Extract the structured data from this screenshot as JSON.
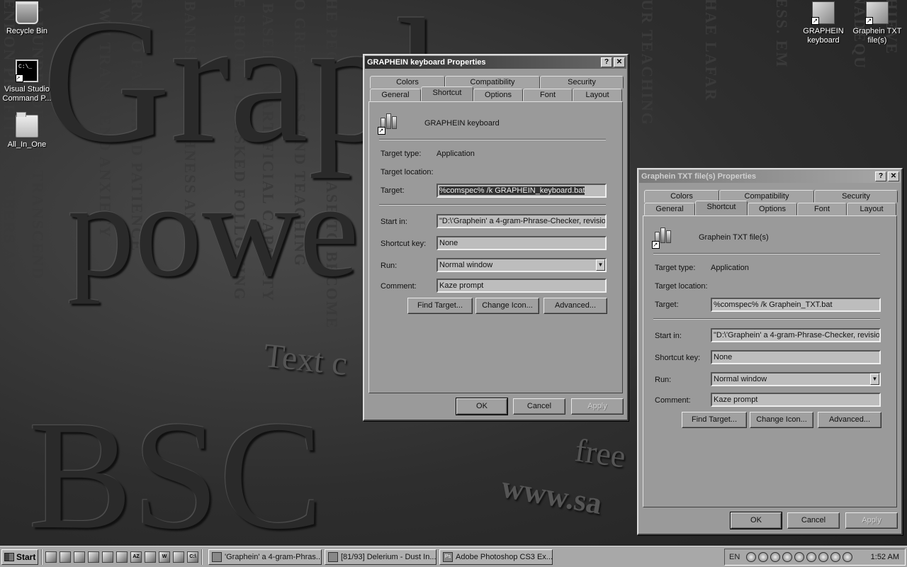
{
  "wallpaper": {
    "big_line1": "Graph -",
    "big_line2": "powe",
    "big_line3": "BSC",
    "small1": "Text c",
    "small2": "free",
    "small3": "www.sa",
    "columns": [
      "RENDON PROFIT: ~ ROBBERS AND",
      "O A HUNDREDFOLD: TRANSCEND",
      "W WU TRANSCEND ANXIETY",
      "URN TO FAITH AND PATIENCE",
      "~ BANISH SELFISHNESS AND",
      "E BASED ON ARTIFICIAL CAPACITY",
      "DO GREATNESS AND TEACHING",
      "LE SHOULD BE ASKED FOLLOWING",
      "THE PEOPLE WILL CEASE TO BECOME",
      "OUR TEACHING",
      "CHAE LAFAR",
      "LESS. EM",
      "INADEQU",
      "THIEVE"
    ]
  },
  "desktop_icons": [
    {
      "label": "Recycle Bin",
      "icon": "recycle-bin-icon"
    },
    {
      "label": "Visual Studio Command P...",
      "icon": "command-prompt-icon"
    },
    {
      "label": "All_In_One",
      "icon": "folder-icon"
    },
    {
      "label": "GRAPHEIN keyboard",
      "icon": "graphein-shortcut-icon"
    },
    {
      "label": "Graphein TXT file(s)",
      "icon": "graphein-shortcut-icon"
    }
  ],
  "dialog1": {
    "title": "GRAPHEIN keyboard Properties",
    "tabs_back": [
      "Colors",
      "Compatibility",
      "Security"
    ],
    "tabs_front": [
      "General",
      "Shortcut",
      "Options",
      "Font",
      "Layout"
    ],
    "name": "GRAPHEIN keyboard",
    "target_type_label": "Target type:",
    "target_type_value": "Application",
    "target_location_label": "Target location:",
    "target_label": "Target:",
    "target_value": "%comspec% /k GRAPHEIN_keyboard.bat",
    "start_in_label": "Start in:",
    "start_in_value": "\"D:\\'Graphein' a 4-gram-Phrase-Checker, revision",
    "shortcut_key_label": "Shortcut key:",
    "shortcut_key_value": "None",
    "run_label": "Run:",
    "run_value": "Normal window",
    "comment_label": "Comment:",
    "comment_value": "Kaze prompt",
    "find_target": "Find Target...",
    "change_icon": "Change Icon...",
    "advanced": "Advanced...",
    "ok": "OK",
    "cancel": "Cancel",
    "apply": "Apply"
  },
  "dialog2": {
    "title": "Graphein TXT file(s) Properties",
    "tabs_back": [
      "Colors",
      "Compatibility",
      "Security"
    ],
    "tabs_front": [
      "General",
      "Shortcut",
      "Options",
      "Font",
      "Layout"
    ],
    "name": "Graphein TXT file(s)",
    "target_type_label": "Target type:",
    "target_type_value": "Application",
    "target_location_label": "Target location:",
    "target_label": "Target:",
    "target_value": "%comspec% /k Graphein_TXT.bat",
    "start_in_label": "Start in:",
    "start_in_value": "\"D:\\'Graphein' a 4-gram-Phrase-Checker, revision",
    "shortcut_key_label": "Shortcut key:",
    "shortcut_key_value": "None",
    "run_label": "Run:",
    "run_value": "Normal window",
    "comment_label": "Comment:",
    "comment_value": "Kaze prompt",
    "find_target": "Find Target...",
    "change_icon": "Change Icon...",
    "advanced": "Advanced...",
    "ok": "OK",
    "cancel": "Cancel",
    "apply": "Apply"
  },
  "taskbar": {
    "start": "Start",
    "tasks": [
      {
        "label": "'Graphein' a 4-gram-Phras...",
        "icon": "folder-icon"
      },
      {
        "label": "[81/93] Delerium - Dust In...",
        "icon": "media-player-icon"
      },
      {
        "label": "Adobe Photoshop CS3 Ex...",
        "icon": "photoshop-icon"
      }
    ],
    "quicklaunch": [
      "AZ",
      "W",
      "C:\\"
    ],
    "lang": "EN",
    "clock": "1:52 AM"
  }
}
